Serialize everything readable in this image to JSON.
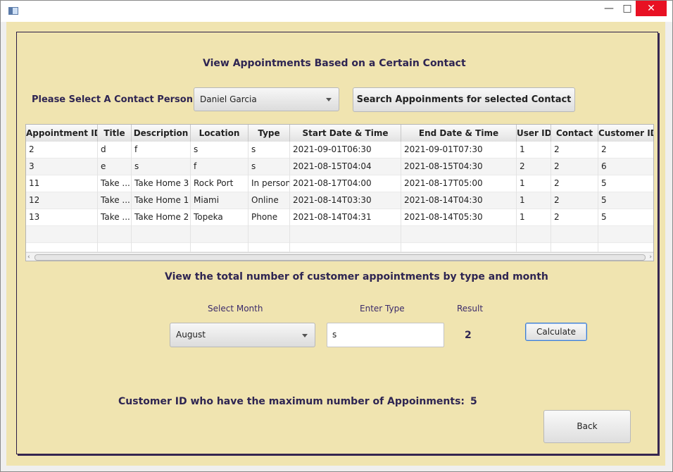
{
  "window": {
    "title": "",
    "controls": {
      "minimize": "—",
      "maximize": "□",
      "close": "✕"
    }
  },
  "page": {
    "heading": "View Appointments Based on a Certain Contact",
    "contact_label": "Please Select A Contact Person:",
    "contact_selected": "Daniel Garcia",
    "search_button": "Search Appoinments for selected Contact"
  },
  "table": {
    "columns": [
      "Appointment ID",
      "Title",
      "Description",
      "Location",
      "Type",
      "Start Date & Time",
      "End Date & Time",
      "User ID",
      "Contact",
      "Customer ID"
    ],
    "rows": [
      [
        "2",
        "d",
        "f",
        "s",
        "s",
        "2021-09-01T06:30",
        "2021-09-01T07:30",
        "1",
        "2",
        "2"
      ],
      [
        "3",
        "e",
        "s",
        "f",
        "s",
        "2021-08-15T04:04",
        "2021-08-15T04:30",
        "2",
        "2",
        "6"
      ],
      [
        "11",
        "Take ...",
        "Take Home 3",
        "Rock Port",
        "In person",
        "2021-08-17T04:00",
        "2021-08-17T05:00",
        "1",
        "2",
        "5"
      ],
      [
        "12",
        "Take ...",
        "Take Home 1",
        "Miami",
        "Online",
        "2021-08-14T03:30",
        "2021-08-14T04:30",
        "1",
        "2",
        "5"
      ],
      [
        "13",
        "Take ...",
        "Take Home 2",
        "Topeka",
        "Phone",
        "2021-08-14T04:31",
        "2021-08-14T05:30",
        "1",
        "2",
        "5"
      ]
    ]
  },
  "totals": {
    "heading": "View the total number of customer appointments by type and month",
    "month_label": "Select Month",
    "month_selected": "August",
    "type_label": "Enter Type",
    "type_value": "s",
    "result_label": "Result",
    "result_value": "2",
    "calculate_button": "Calculate"
  },
  "max": {
    "label": "Customer ID who have the maximum number of Appoinments:",
    "value": "5"
  },
  "back_button": "Back"
}
